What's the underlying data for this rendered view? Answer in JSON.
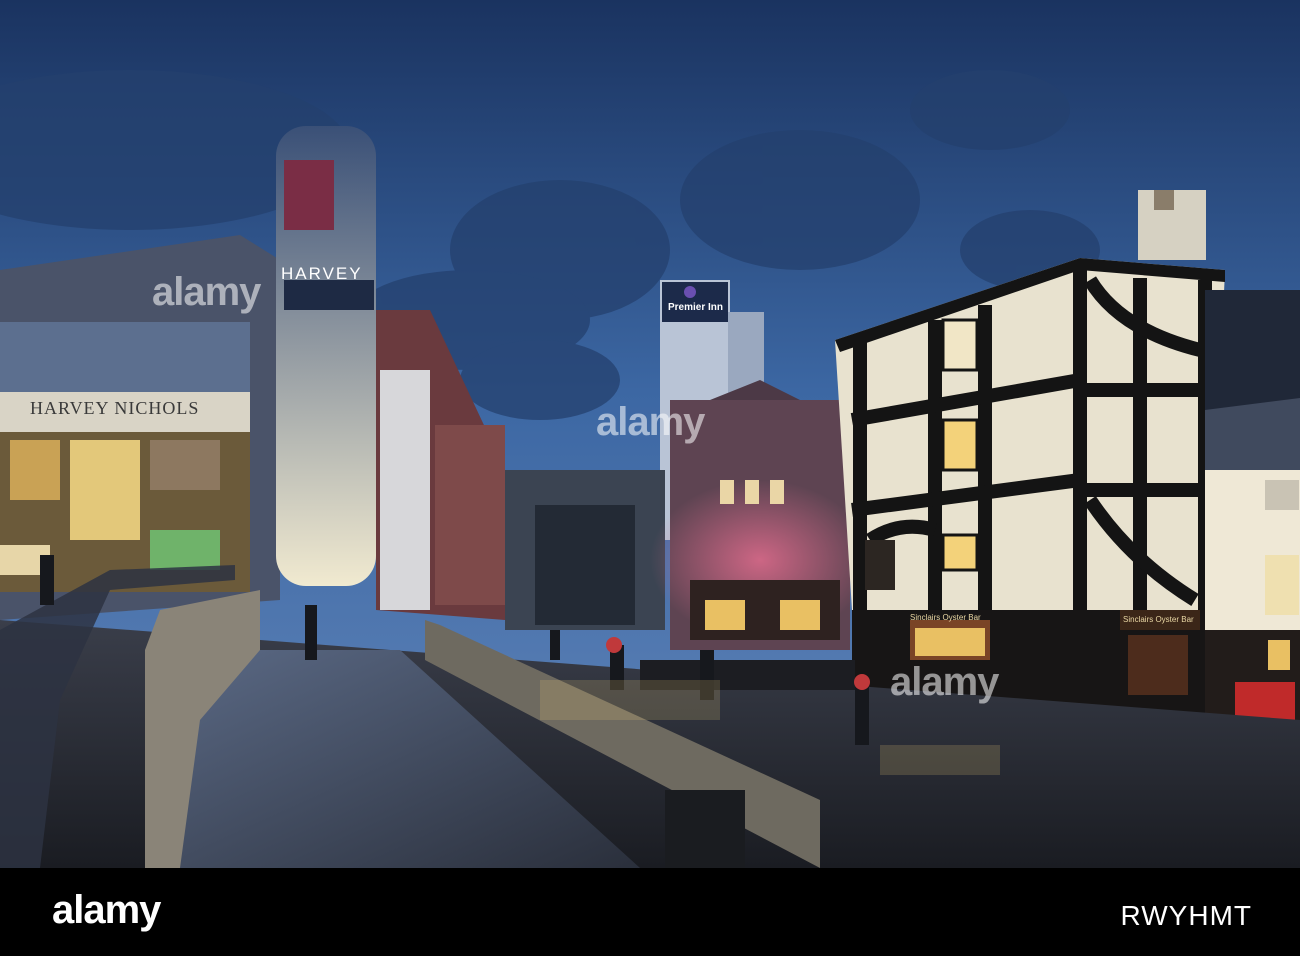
{
  "photo": {
    "signs": {
      "harvey_nichols": "HARVEY NICHOLS",
      "harvey_tower": "HARVEY",
      "premier_inn": "Premier Inn",
      "oyster_bar_left": "Sinclairs Oyster Bar",
      "oyster_bar_right": "Sinclairs Oyster Bar"
    },
    "colors": {
      "sky_top": "#1d3763",
      "sky_mid": "#3f6aa6",
      "sky_low": "#5d83b8",
      "tudor_white": "#e8e2cf",
      "tudor_black": "#141414",
      "pavement": "#2b2e38",
      "window_glow": "#f3d27a"
    }
  },
  "watermark": "alamy",
  "footer": {
    "logo": "alamy",
    "image_ref": "RWYHMT"
  }
}
